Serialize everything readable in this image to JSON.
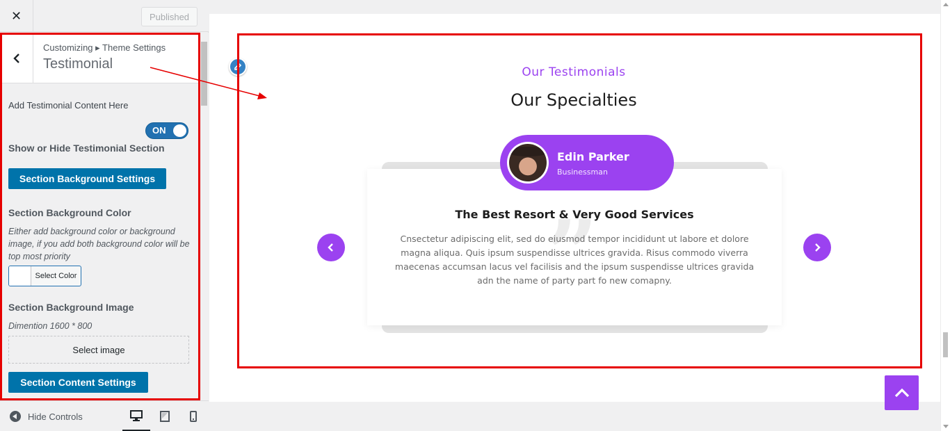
{
  "topbar": {
    "close_symbol": "✕",
    "published_label": "Published"
  },
  "panel": {
    "breadcrumb": "Customizing ▸ Theme Settings",
    "title": "Testimonial"
  },
  "controls": {
    "add_content_desc": "Add Testimonial Content Here",
    "toggle_label": "ON",
    "toggle_state": true,
    "show_hide_label": "Show or Hide Testimonial Section",
    "bg_settings_button": "Section Background Settings",
    "bg_color_label": "Section Background Color",
    "bg_color_note": "Either add background color or background image, if you add both background color will be top most priority",
    "select_color_button": "Select Color",
    "bg_image_label": "Section Background Image",
    "bg_image_note": "Dimention 1600 * 800",
    "select_image_button": "Select image",
    "content_settings_button": "Section Content Settings"
  },
  "footer": {
    "hide_controls_label": "Hide Controls",
    "devices": [
      "desktop-icon",
      "tablet-icon",
      "mobile-icon"
    ]
  },
  "preview": {
    "subtitle": "Our Testimonials",
    "title": "Our Specialties",
    "author_name": "Edin Parker",
    "author_role": "Businessman",
    "review_title": "The Best Resort & Very Good Services",
    "review_text": "Cnsectetur adipiscing elit, sed do eiusmod tempor incididunt ut labore et dolore magna aliqua. Quis ipsum suspendisse ultrices gravida. Risus commodo viverra maecenas accumsan lacus vel facilisis and the ipsum suspendisse ultrices gravida adn the name of party part fo new comapny.",
    "quote_glyph": "”"
  },
  "colors": {
    "accent": "#9b42f0",
    "wp_button": "#0073aa",
    "annotation": "#e60000"
  }
}
